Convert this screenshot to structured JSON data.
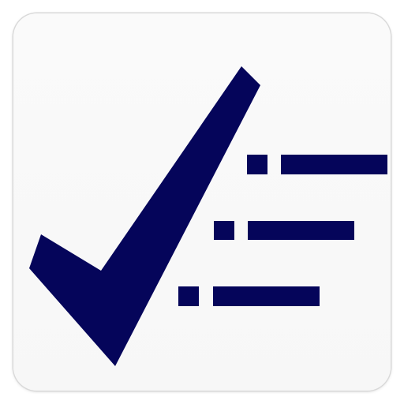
{
  "app_icon": {
    "icon": "checklist-icon",
    "background_color": "#f8f8f8",
    "glyph_color": "#05055a",
    "checklist_items_count": 3
  }
}
